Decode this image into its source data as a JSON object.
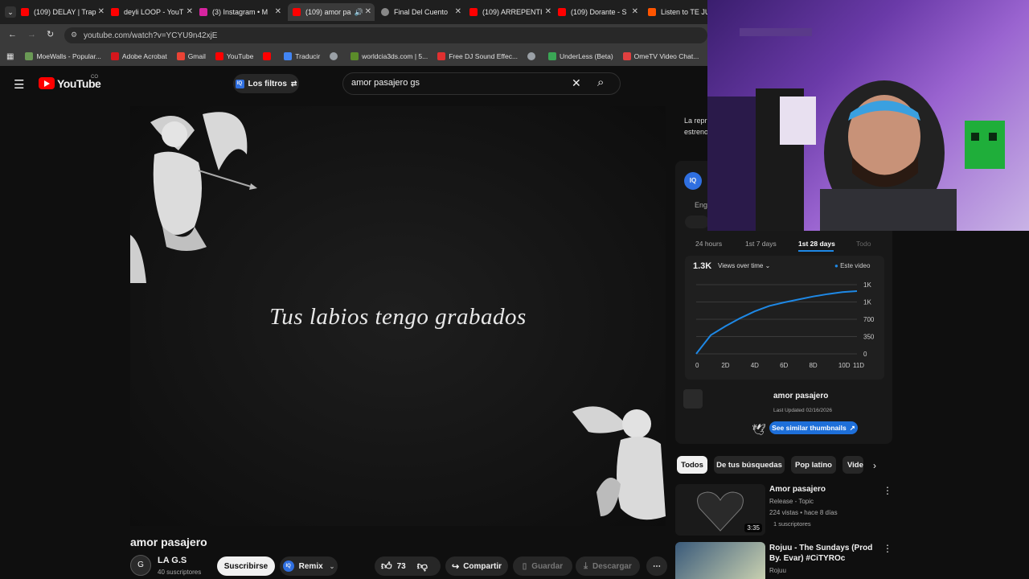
{
  "tabs": [
    {
      "title": "(109) DELAY | Trap",
      "color": "#ff0000"
    },
    {
      "title": "deyli LOOP - YouT",
      "color": "#ff0000"
    },
    {
      "title": "(3) Instagram • M",
      "color": "#d6249f"
    },
    {
      "title": "(109) amor pa",
      "color": "#ff0000"
    },
    {
      "title": "Final Del Cuento",
      "color": "#888888"
    },
    {
      "title": "(109) ARREPENTI",
      "color": "#ff0000"
    },
    {
      "title": "(109) Dorante - S",
      "color": "#ff0000"
    },
    {
      "title": "Listen to TE JURO",
      "color": "#ff5500"
    }
  ],
  "browser": {
    "url": "youtube.com/watch?v=YCYU9n42xjE"
  },
  "bookmarks": [
    {
      "label": "MoeWalls - Popular...",
      "color": "#6a9955"
    },
    {
      "label": "Adobe Acrobat",
      "color": "#d4161c"
    },
    {
      "label": "Gmail",
      "color": "#ea4335"
    },
    {
      "label": "YouTube",
      "color": "#ff0000"
    },
    {
      "label": "",
      "color": "#ff0000"
    },
    {
      "label": "Traducir",
      "color": "#4285f4"
    },
    {
      "label": "",
      "color": "#9aa0a6"
    },
    {
      "label": "worldcia3ds.com | 5...",
      "color": "#5b8c2a"
    },
    {
      "label": "Free DJ Sound Effec...",
      "color": "#e03030"
    },
    {
      "label": "",
      "color": "#9aa0a6"
    },
    {
      "label": "UnderLess (Beta)",
      "color": "#3aa655"
    },
    {
      "label": "OmeTV Video Chat...",
      "color": "#e04040"
    }
  ],
  "yt": {
    "logo_text": "YouTube",
    "country": "CO",
    "filters": "Los filtros",
    "search_value": "amor pasajero gs",
    "lyric": "Tus labios tengo grabados",
    "video_title": "amor pasajero",
    "channel": "LA G.S",
    "subs": "40 suscriptores",
    "subscribe": "Suscribirse",
    "remix": "Remix",
    "likes": "73",
    "share": "Compartir",
    "save": "Guardar",
    "download": "Descargar",
    "premiere_text": "La repr\nestreno"
  },
  "vidiq": {
    "badge": "IQ",
    "eng": "Eng",
    "ranges": [
      "24 hours",
      "1st 7 days",
      "1st 28 days",
      "Todo"
    ],
    "active_range": "1st 28 days",
    "total": "1.3K",
    "metric": "Views over time",
    "legend": "Este video",
    "song_title": "amor pasajero",
    "updated": "Last Updated 02/16/2026",
    "similar": "See similar thumbnails"
  },
  "chart_data": {
    "type": "line",
    "x": [
      0,
      1,
      2,
      3,
      4,
      5,
      6,
      7,
      8,
      9,
      10,
      11
    ],
    "xticks": [
      "0",
      "2D",
      "4D",
      "6D",
      "8D",
      "10D",
      "11D"
    ],
    "yticks": [
      "1K",
      "1K",
      "700",
      "350",
      "0"
    ],
    "series": [
      {
        "name": "Este video",
        "values": [
          0,
          380,
          560,
          720,
          860,
          970,
          1040,
          1100,
          1160,
          1210,
          1250,
          1270
        ]
      }
    ],
    "ylim": [
      0,
      1400
    ],
    "color": "#1e88e5"
  },
  "chips": [
    "Todos",
    "De tus búsquedas",
    "Pop latino",
    "Vide"
  ],
  "recs": [
    {
      "title": "Amor pasajero",
      "meta1": "Release - Topic",
      "meta2": "224 vistas • hace 8 días",
      "meta3": "1 suscriptores",
      "duration": "3:35"
    },
    {
      "title": "Rojuu - The Sundays (Prod By. Evar) #CiTYROc",
      "meta1": "Rojuu",
      "meta2": "",
      "meta3": "",
      "duration": ""
    }
  ]
}
